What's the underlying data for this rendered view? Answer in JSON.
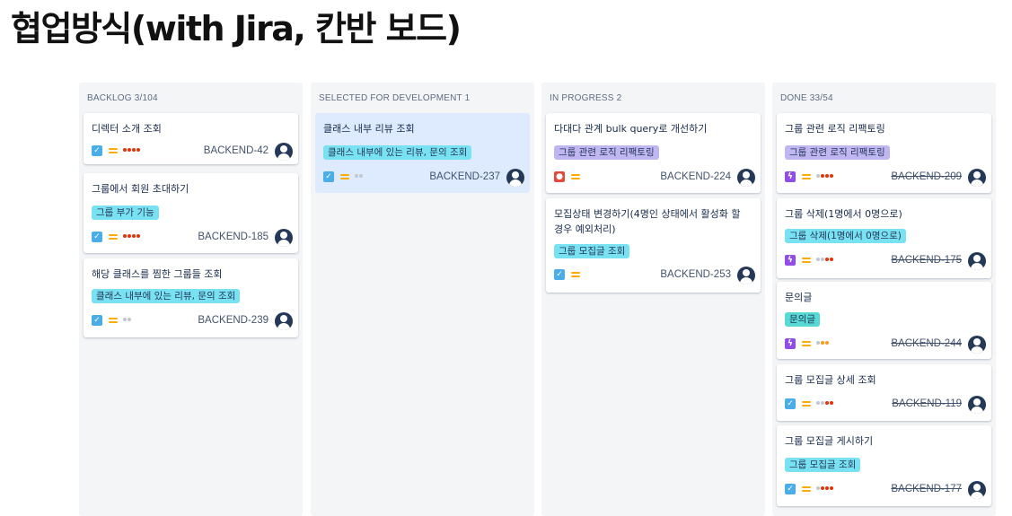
{
  "page": {
    "title": "협업방식(with Jira, 칸반 보드)"
  },
  "columns": [
    {
      "name": "BACKLOG",
      "count": "3/104",
      "cards": [
        {
          "title": "디렉터 소개 조회",
          "epic": "",
          "type": "task",
          "points": "red4",
          "key": "BACKEND-42",
          "done": false
        },
        {
          "title": "그룹에서 회원 초대하기",
          "epic": "그룹 부가 기능",
          "type": "task",
          "points": "red4",
          "key": "BACKEND-185",
          "done": false
        },
        {
          "title": "해당 클래스를 찜한 그룹들 조회",
          "epic": "클래스 내부에 있는 리뷰, 문의 조회",
          "type": "task",
          "points": "grey2",
          "key": "BACKEND-239",
          "done": false
        }
      ]
    },
    {
      "name": "SELECTED FOR DEVELOPMENT",
      "count": "1",
      "cards": [
        {
          "title": "클래스 내부 리뷰 조회",
          "epic": "클래스 내부에 있는 리뷰, 문의 조회",
          "type": "task",
          "points": "grey2",
          "key": "BACKEND-237",
          "done": false
        }
      ]
    },
    {
      "name": "IN PROGRESS",
      "count": "2",
      "cards": [
        {
          "title": "다대다 관계 bulk query로 개선하기",
          "epic": "그룹 관련 로직 리팩토링",
          "type": "bug",
          "points": "",
          "key": "BACKEND-224",
          "done": false
        },
        {
          "title": "모집상태 변경하기(4명인 상태에서 활성화 할 경우 예외처리)",
          "epic": "그룹 모집글 조회",
          "type": "task",
          "points": "",
          "key": "BACKEND-253",
          "done": false
        }
      ]
    },
    {
      "name": "DONE",
      "count": "33/54",
      "cards": [
        {
          "title": "그룹 관련 로직 리팩토링",
          "epic": "그룹 관련 로직 리팩토링",
          "type": "epic",
          "points": "red3",
          "key": "BACKEND-209",
          "done": true
        },
        {
          "title": "그룹 삭제(1명에서 0명으로)",
          "epic": "그룹 삭제(1명에서 0명으로)",
          "type": "epic",
          "points": "red3",
          "key": "BACKEND-175",
          "done": true
        },
        {
          "title": "문의글",
          "epic": "문의글",
          "type": "epic",
          "points": "orange3",
          "key": "BACKEND-244",
          "done": true
        },
        {
          "title": "그룹 모집글 상세 조회",
          "epic": "",
          "type": "task",
          "points": "red2",
          "key": "BACKEND-119",
          "done": true
        },
        {
          "title": "그룹 모집글 게시하기",
          "epic": "그룹 모집글 조회",
          "type": "task",
          "points": "red3",
          "key": "BACKEND-177",
          "done": true
        }
      ]
    }
  ],
  "colors": {
    "column_bg": "#f4f5f7",
    "selected_card": "#deebff",
    "epic_cyan": "#79e2f2",
    "epic_purple": "#c0b6f2",
    "task": "#4bade8",
    "bug": "#e5493a",
    "epic_type": "#904ee2",
    "avatar": "#253858"
  }
}
